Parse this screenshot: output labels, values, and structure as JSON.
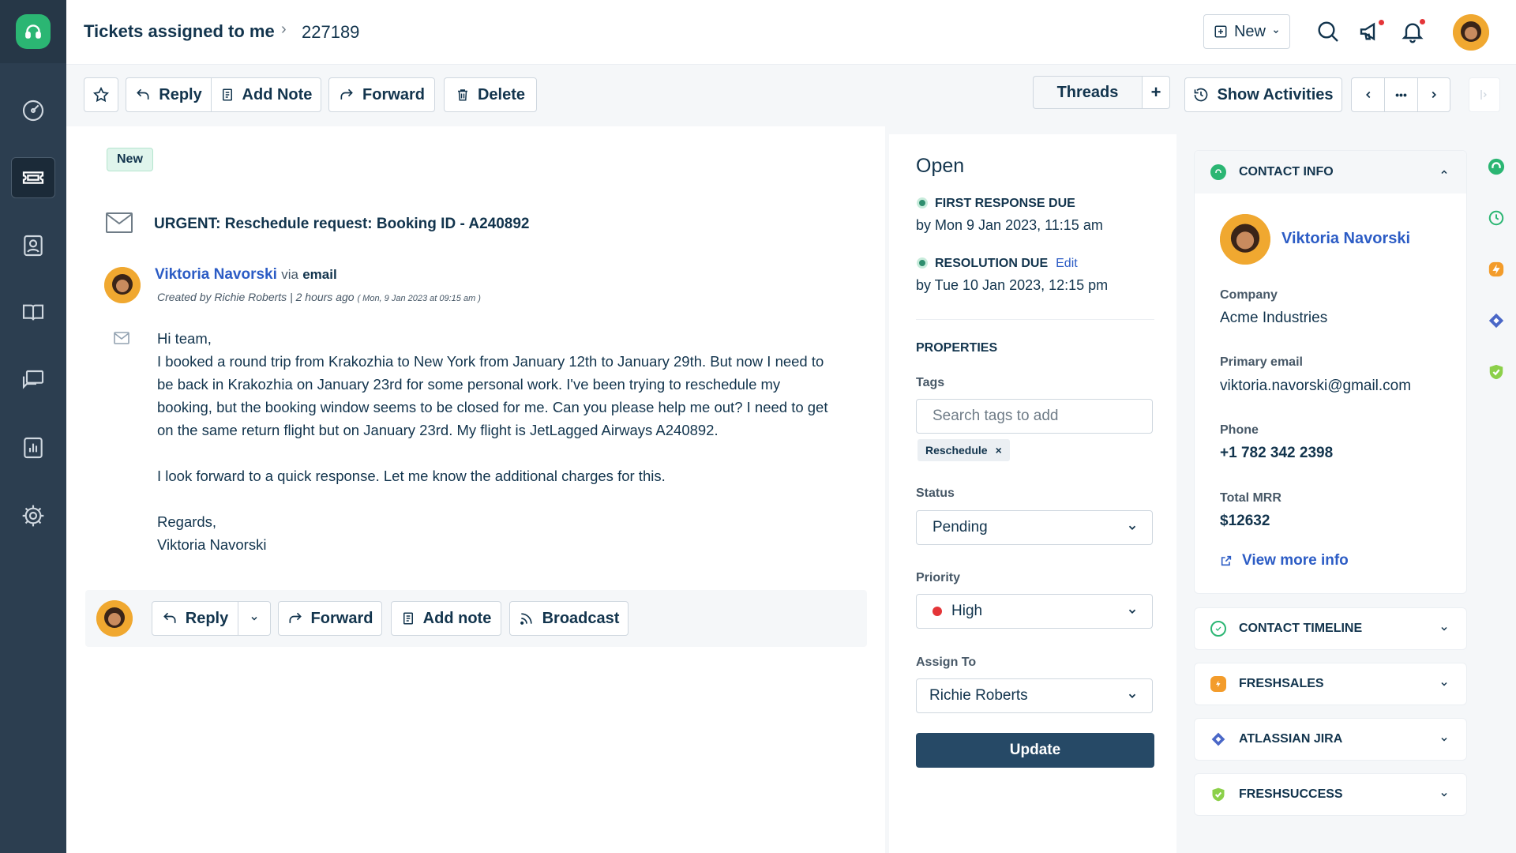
{
  "breadcrumb": {
    "title": "Tickets assigned to me",
    "separator": "›",
    "ticket_id": "227189"
  },
  "header": {
    "new_label": "New"
  },
  "toolbar": {
    "reply": "Reply",
    "add_note": "Add Note",
    "forward": "Forward",
    "delete": "Delete",
    "threads": "Threads",
    "plus": "+",
    "show_activities": "Show Activities",
    "more": "•••"
  },
  "ticket": {
    "badge": "New",
    "subject": "URGENT: Reschedule request: Booking ID - A240892",
    "sender_name": "Viktoria Navorski",
    "via": "via",
    "channel": "email",
    "created": "Created by Richie Roberts | 2 hours ago",
    "created_ts": "( Mon, 9 Jan 2023 at 09:15 am )",
    "body": {
      "greeting": "Hi team,",
      "p1": "I booked a round trip from Krakozhia to New York from January 12th to January 29th. But now I need to be back in Krakozhia on January 23rd for some personal work. I've been trying to reschedule my booking, but the booking window seems to be closed for me. Can you please help me out? I need to get on the same return flight but on January 23rd. My flight is JetLagged Airways A240892.",
      "p2": "I look forward to a quick response. Let me know the additional charges for this.",
      "regards": "Regards,",
      "signature": "Viktoria Navorski"
    }
  },
  "reply_bar": {
    "reply": "Reply",
    "forward": "Forward",
    "add_note": "Add note",
    "broadcast": "Broadcast"
  },
  "properties": {
    "status_heading": "Open",
    "first_response_label": "FIRST RESPONSE DUE",
    "first_response_by": "by  Mon 9 Jan 2023, 11:15 am",
    "resolution_label": "RESOLUTION DUE",
    "resolution_edit": "Edit",
    "resolution_by": "by  Tue 10 Jan 2023, 12:15 pm",
    "section_title": "PROPERTIES",
    "tags_label": "Tags",
    "tags_placeholder": "Search tags to add",
    "tag": "Reschedule",
    "tag_remove": "×",
    "status_label": "Status",
    "status_value": "Pending",
    "priority_label": "Priority",
    "priority_value": "High",
    "assign_label": "Assign To",
    "assign_value": "Richie Roberts",
    "update": "Update"
  },
  "contact": {
    "header": "CONTACT INFO",
    "name": "Viktoria Navorski",
    "company_label": "Company",
    "company": "Acme Industries",
    "email_label": "Primary email",
    "email": "viktoria.navorski@gmail.com",
    "phone_label": "Phone",
    "phone": "+1 782 342 2398",
    "mrr_label": "Total MRR",
    "mrr": "$12632",
    "view_more": "View more info"
  },
  "apps": {
    "timeline": "CONTACT TIMELINE",
    "freshsales": "FRESHSALES",
    "jira": "ATLASSIAN JIRA",
    "freshsuccess": "FRESHSUCCESS"
  },
  "colors": {
    "nav_bg": "#2c3e50",
    "brand_green": "#2bb673",
    "link_blue": "#2c5cc5",
    "priority_red": "#e43538",
    "update_bg": "#264966",
    "freshsales_orange": "#f39c2b",
    "jira_blue": "#4a67c7",
    "freshsuccess_green": "#8cd04a"
  },
  "icons": [
    "headset-icon",
    "dashboard-icon",
    "ticket-icon",
    "contacts-icon",
    "book-icon",
    "chat-icon",
    "reports-icon",
    "gear-icon",
    "search-icon",
    "megaphone-icon",
    "bell-icon",
    "star-icon",
    "reply-icon",
    "note-icon",
    "forward-icon",
    "trash-icon",
    "clock-icon",
    "chevron-left-icon",
    "chevron-right-icon",
    "envelope-icon",
    "broadcast-icon",
    "external-link-icon"
  ]
}
